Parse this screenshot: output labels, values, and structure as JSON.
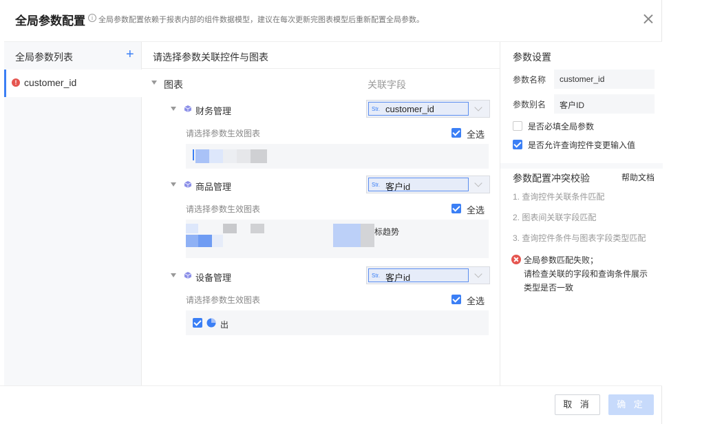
{
  "header": {
    "title": "全局参数配置",
    "subtitle": "全局参数配置依赖于报表内部的组件数据模型，建议在每次更新完图表模型后重新配置全局参数。"
  },
  "left": {
    "title": "全局参数列表",
    "add_icon": "plus-icon",
    "items": [
      {
        "label": "customer_id",
        "status": "error"
      }
    ]
  },
  "middle": {
    "title": "请选择参数关联控件与图表",
    "root_label": "图表",
    "field_header": "关联字段",
    "groups": [
      {
        "name": "财务管理",
        "field_type": "Str.",
        "field": "customer_id",
        "hint": "请选择参数生效图表",
        "select_all": "全选",
        "charts": []
      },
      {
        "name": "商品管理",
        "field_type": "Str.",
        "field": "客户id",
        "hint": "请选择参数生效图表",
        "select_all": "全选",
        "charts": [
          {
            "label": "标趋势"
          }
        ]
      },
      {
        "name": "设备管理",
        "field_type": "Str.",
        "field": "客户id",
        "hint": "请选择参数生效图表",
        "select_all": "全选",
        "charts": [
          {
            "label": "出"
          }
        ]
      }
    ]
  },
  "right": {
    "title": "参数设置",
    "name_label": "参数名称",
    "name_value": "customer_id",
    "alias_label": "参数别名",
    "alias_value": "客户ID",
    "required_label": "是否必填全局参数",
    "required_checked": false,
    "allow_label": "是否允许查询控件变更输入值",
    "allow_checked": true,
    "check_title": "参数配置冲突校验",
    "help_label": "帮助文档",
    "steps": [
      "1. 查询控件关联条件匹配",
      "2. 图表间关联字段匹配",
      "3. 查询控件条件与图表字段类型匹配"
    ],
    "error_line1": "全局参数匹配失败；",
    "error_line2": "请检查关联的字段和查询条件展示类型是否一致"
  },
  "footer": {
    "cancel_label": "取 消",
    "ok_label": "确 定"
  },
  "colors": {
    "accent": "#3b7ff5",
    "error": "#e5554f",
    "ok_disabled": "#c7dafb"
  }
}
